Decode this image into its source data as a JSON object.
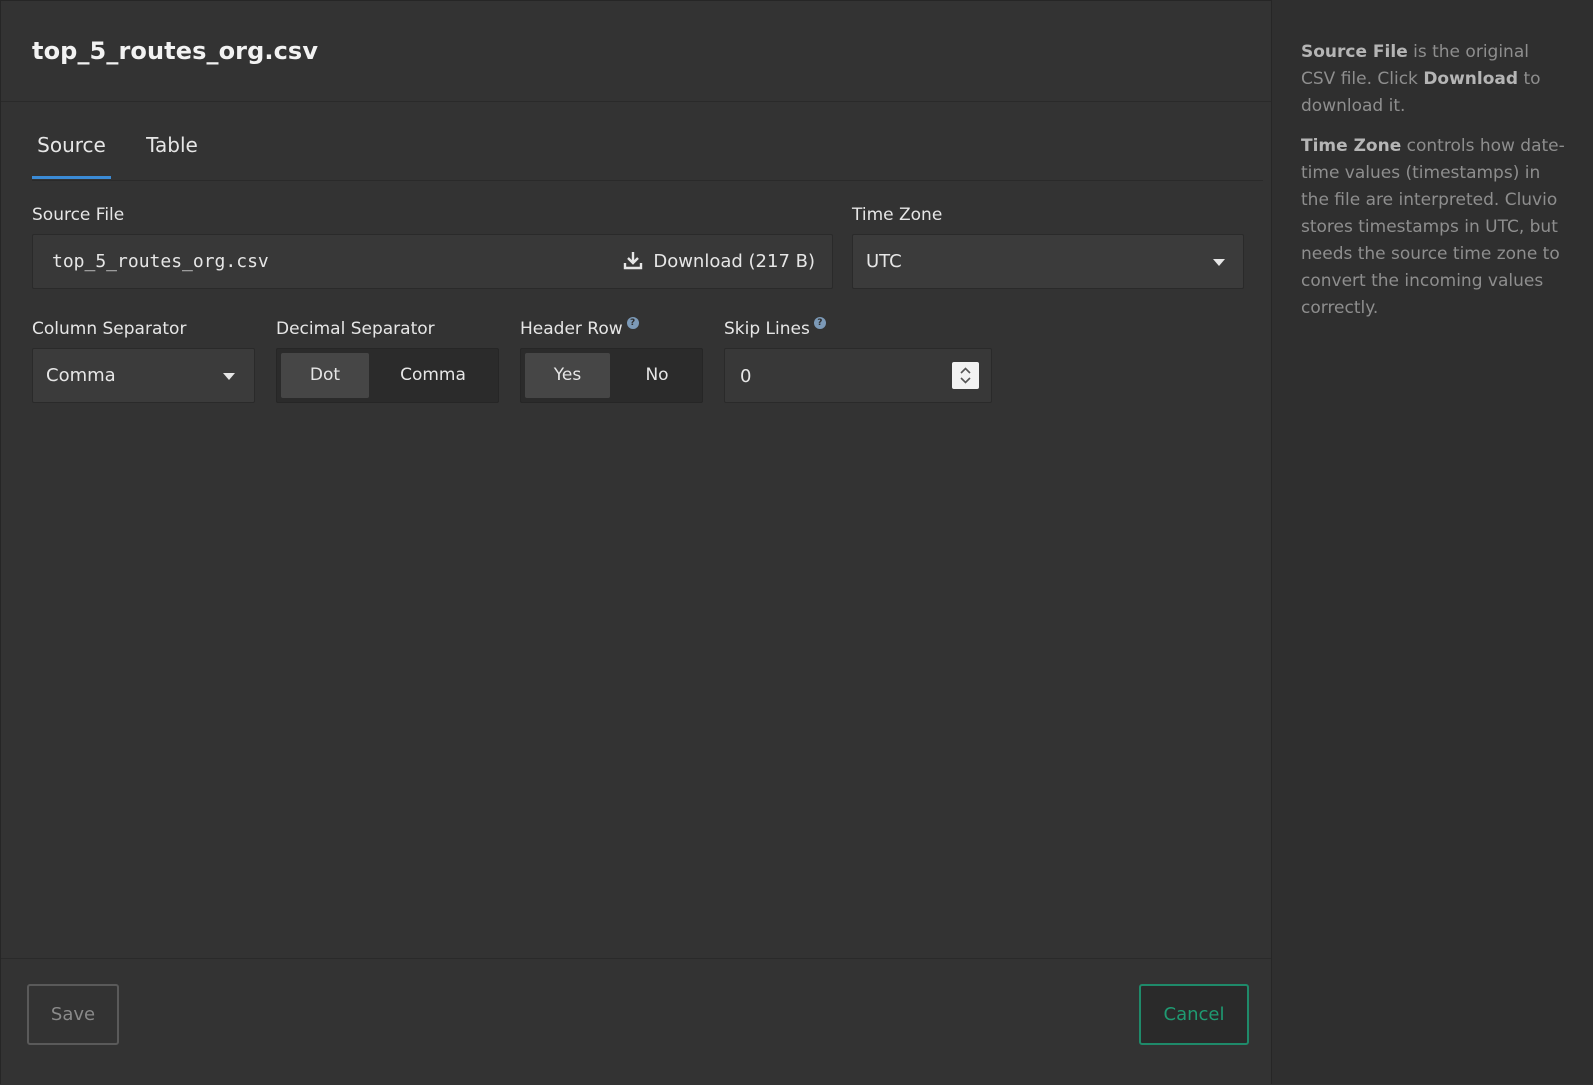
{
  "title": "top_5_routes_org.csv",
  "tabs": [
    {
      "label": "Source",
      "active": true
    },
    {
      "label": "Table",
      "active": false
    }
  ],
  "source_file": {
    "label": "Source File",
    "value": "top_5_routes_org.csv",
    "download_label": "Download (217 B)",
    "download_icon": "download-icon"
  },
  "time_zone": {
    "label": "Time Zone",
    "value": "UTC"
  },
  "column_separator": {
    "label": "Column Separator",
    "value": "Comma"
  },
  "decimal_separator": {
    "label": "Decimal Separator",
    "options": [
      "Dot",
      "Comma"
    ],
    "selected": "Dot"
  },
  "header_row": {
    "label": "Header Row",
    "help": "?",
    "options": [
      "Yes",
      "No"
    ],
    "selected": "Yes"
  },
  "skip_lines": {
    "label": "Skip Lines",
    "help": "?",
    "value": "0"
  },
  "footer": {
    "save_label": "Save",
    "cancel_label": "Cancel"
  },
  "help_panel": {
    "p1": {
      "bold1": "Source File",
      "text1": " is the original CSV file. Click ",
      "bold2": "Download",
      "text2": " to download it."
    },
    "p2": {
      "bold1": "Time Zone",
      "text1": " controls how date-time values (timestamps) in the file are interpreted. Cluvio stores timestamps in UTC, but needs the source time zone to convert the incoming values correctly."
    }
  },
  "colors": {
    "accent_tab": "#3b8bd6",
    "cancel": "#1f9a72",
    "background": "#333333",
    "help_badge": "#7c9ab8"
  }
}
